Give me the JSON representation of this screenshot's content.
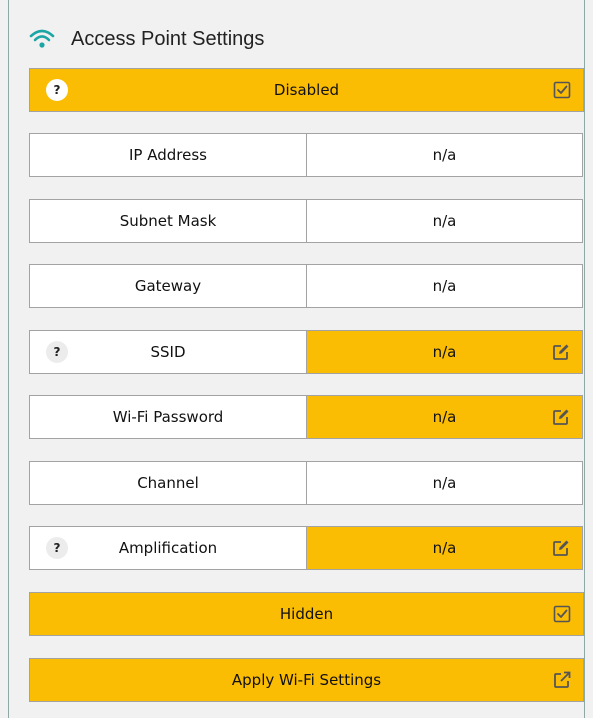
{
  "header": {
    "title": "Access Point Settings",
    "icon": "wifi-icon"
  },
  "colors": {
    "accent": "#fbbc04",
    "wifi": "#1ba5a5",
    "border": "#a3a3a3"
  },
  "status": {
    "label": "Disabled",
    "help": "?",
    "icon": "checkbox-checked-icon"
  },
  "fields": [
    {
      "label": "IP Address",
      "value": "n/a"
    },
    {
      "label": "Subnet Mask",
      "value": "n/a"
    },
    {
      "label": "Gateway",
      "value": "n/a"
    },
    {
      "label": "SSID",
      "value": "n/a",
      "help": "?",
      "icon": "edit-icon"
    },
    {
      "label": "Wi-Fi Password",
      "value": "n/a",
      "icon": "edit-icon"
    },
    {
      "label": "Channel",
      "value": "n/a"
    },
    {
      "label": "Amplification",
      "value": "n/a",
      "help": "?",
      "icon": "edit-icon"
    }
  ],
  "hidden": {
    "label": "Hidden",
    "icon": "checkbox-checked-icon"
  },
  "apply": {
    "label": "Apply Wi-Fi Settings",
    "icon": "external-link-icon"
  }
}
